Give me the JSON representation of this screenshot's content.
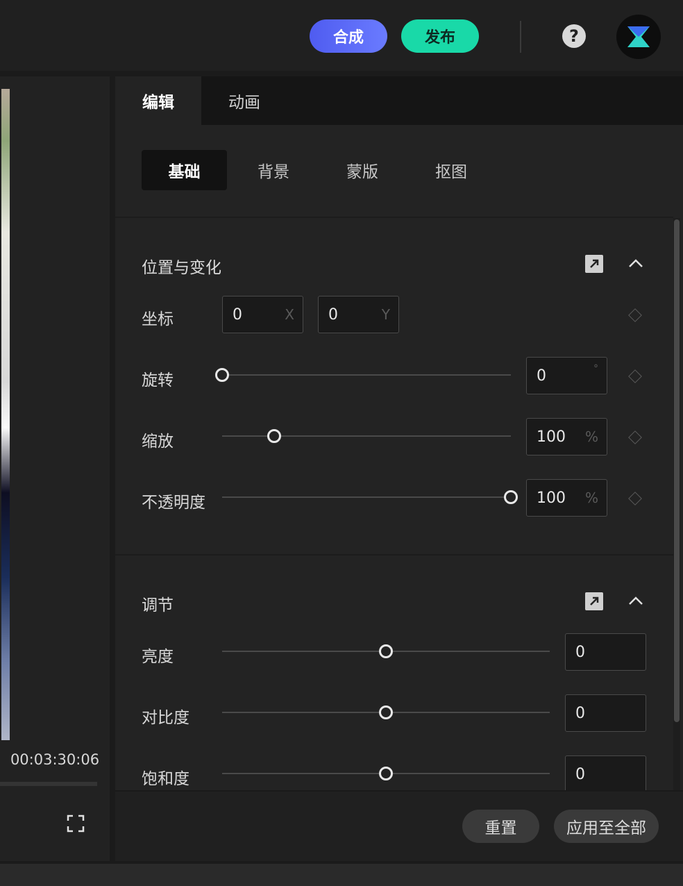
{
  "topbar": {
    "compose_label": "合成",
    "publish_label": "发布",
    "help_glyph": "?",
    "compose_color": "#5a68f5",
    "publish_color": "#19d9a8"
  },
  "preview": {
    "timecode": "00:03:30:06"
  },
  "tabs": [
    {
      "label": "编辑",
      "active": true
    },
    {
      "label": "动画",
      "active": false
    }
  ],
  "subtabs": [
    {
      "label": "基础",
      "active": true
    },
    {
      "label": "背景",
      "active": false
    },
    {
      "label": "蒙版",
      "active": false
    },
    {
      "label": "抠图",
      "active": false
    }
  ],
  "transform": {
    "title": "位置与变化",
    "position": {
      "label": "坐标",
      "x": "0",
      "x_unit": "X",
      "y": "0",
      "y_unit": "Y"
    },
    "rotation": {
      "label": "旋转",
      "value": "0",
      "unit": "°",
      "level": 0
    },
    "scale": {
      "label": "缩放",
      "value": "100",
      "unit": "%",
      "level": 0.18
    },
    "opacity": {
      "label": "不透明度",
      "value": "100",
      "unit": "%",
      "level": 1
    }
  },
  "adjust": {
    "title": "调节",
    "brightness": {
      "label": "亮度",
      "value": "0",
      "level": 0.5
    },
    "contrast": {
      "label": "对比度",
      "value": "0",
      "level": 0.5
    },
    "saturation": {
      "label": "饱和度",
      "value": "0",
      "level": 0.5
    }
  },
  "footer": {
    "reset_label": "重置",
    "apply_all_label": "应用至全部"
  }
}
